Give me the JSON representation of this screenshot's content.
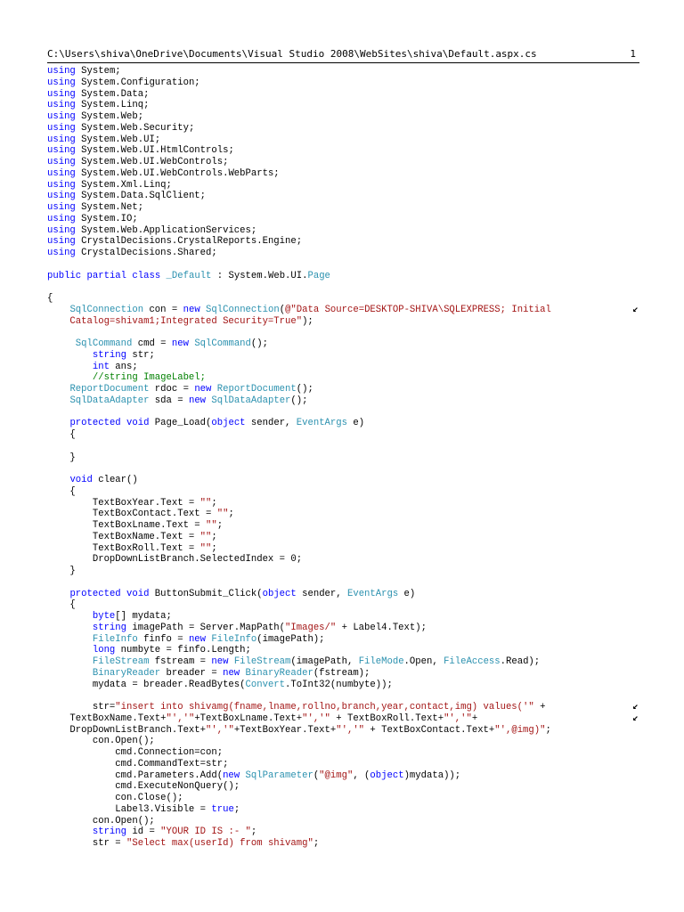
{
  "header": {
    "path": "C:\\Users\\shiva\\OneDrive\\Documents\\Visual Studio 2008\\WebSites\\shiva\\Default.aspx.cs",
    "page_number": "1"
  },
  "wrap_glyph": "↙",
  "colors": {
    "keyword": "#0000ff",
    "type": "#2b91af",
    "string": "#a31515",
    "comment": "#008000"
  },
  "code_lines": [
    [
      [
        "kw",
        "using"
      ],
      [
        "p",
        " System;"
      ]
    ],
    [
      [
        "kw",
        "using"
      ],
      [
        "p",
        " System.Configuration;"
      ]
    ],
    [
      [
        "kw",
        "using"
      ],
      [
        "p",
        " System.Data;"
      ]
    ],
    [
      [
        "kw",
        "using"
      ],
      [
        "p",
        " System.Linq;"
      ]
    ],
    [
      [
        "kw",
        "using"
      ],
      [
        "p",
        " System.Web;"
      ]
    ],
    [
      [
        "kw",
        "using"
      ],
      [
        "p",
        " System.Web.Security;"
      ]
    ],
    [
      [
        "kw",
        "using"
      ],
      [
        "p",
        " System.Web.UI;"
      ]
    ],
    [
      [
        "kw",
        "using"
      ],
      [
        "p",
        " System.Web.UI.HtmlControls;"
      ]
    ],
    [
      [
        "kw",
        "using"
      ],
      [
        "p",
        " System.Web.UI.WebControls;"
      ]
    ],
    [
      [
        "kw",
        "using"
      ],
      [
        "p",
        " System.Web.UI.WebControls.WebParts;"
      ]
    ],
    [
      [
        "kw",
        "using"
      ],
      [
        "p",
        " System.Xml.Linq;"
      ]
    ],
    [
      [
        "kw",
        "using"
      ],
      [
        "p",
        " System.Data.SqlClient;"
      ]
    ],
    [
      [
        "kw",
        "using"
      ],
      [
        "p",
        " System.Net;"
      ]
    ],
    [
      [
        "kw",
        "using"
      ],
      [
        "p",
        " System.IO;"
      ]
    ],
    [
      [
        "kw",
        "using"
      ],
      [
        "p",
        " System.Web.ApplicationServices;"
      ]
    ],
    [
      [
        "kw",
        "using"
      ],
      [
        "p",
        " CrystalDecisions.CrystalReports.Engine;"
      ]
    ],
    [
      [
        "kw",
        "using"
      ],
      [
        "p",
        " CrystalDecisions.Shared;"
      ]
    ],
    [],
    [
      [
        "kw",
        "public"
      ],
      [
        "p",
        " "
      ],
      [
        "kw",
        "partial"
      ],
      [
        "p",
        " "
      ],
      [
        "kw",
        "class"
      ],
      [
        "p",
        " "
      ],
      [
        "ty",
        "_Default"
      ],
      [
        "p",
        " : System.Web.UI."
      ],
      [
        "ty",
        "Page"
      ]
    ],
    [],
    [
      [
        "p",
        "{"
      ]
    ],
    [
      [
        "p",
        "    "
      ],
      [
        "ty",
        "SqlConnection"
      ],
      [
        "p",
        " con = "
      ],
      [
        "kw",
        "new"
      ],
      [
        "p",
        " "
      ],
      [
        "ty",
        "SqlConnection"
      ],
      [
        "p",
        "("
      ],
      [
        "st",
        "@\"Data Source=DESKTOP-SHIVA\\SQLEXPRESS; Initial"
      ],
      [
        "wrap",
        ""
      ]
    ],
    [
      [
        "st",
        "    Catalog=shivam1;Integrated Security=True\""
      ],
      [
        "p",
        ");"
      ]
    ],
    [],
    [
      [
        "p",
        "     "
      ],
      [
        "ty",
        "SqlCommand"
      ],
      [
        "p",
        " cmd = "
      ],
      [
        "kw",
        "new"
      ],
      [
        "p",
        " "
      ],
      [
        "ty",
        "SqlCommand"
      ],
      [
        "p",
        "();"
      ]
    ],
    [
      [
        "p",
        "        "
      ],
      [
        "kw",
        "string"
      ],
      [
        "p",
        " str;"
      ]
    ],
    [
      [
        "p",
        "        "
      ],
      [
        "kw",
        "int"
      ],
      [
        "p",
        " ans;"
      ]
    ],
    [
      [
        "p",
        "        "
      ],
      [
        "cm",
        "//string ImageLabel;"
      ]
    ],
    [
      [
        "p",
        "    "
      ],
      [
        "ty",
        "ReportDocument"
      ],
      [
        "p",
        " rdoc = "
      ],
      [
        "kw",
        "new"
      ],
      [
        "p",
        " "
      ],
      [
        "ty",
        "ReportDocument"
      ],
      [
        "p",
        "();"
      ]
    ],
    [
      [
        "p",
        "    "
      ],
      [
        "ty",
        "SqlDataAdapter"
      ],
      [
        "p",
        " sda = "
      ],
      [
        "kw",
        "new"
      ],
      [
        "p",
        " "
      ],
      [
        "ty",
        "SqlDataAdapter"
      ],
      [
        "p",
        "();"
      ]
    ],
    [],
    [
      [
        "p",
        "    "
      ],
      [
        "kw",
        "protected"
      ],
      [
        "p",
        " "
      ],
      [
        "kw",
        "void"
      ],
      [
        "p",
        " Page_Load("
      ],
      [
        "kw",
        "object"
      ],
      [
        "p",
        " sender, "
      ],
      [
        "ty",
        "EventArgs"
      ],
      [
        "p",
        " e)"
      ]
    ],
    [
      [
        "p",
        "    {"
      ]
    ],
    [],
    [
      [
        "p",
        "    }"
      ]
    ],
    [],
    [
      [
        "p",
        "    "
      ],
      [
        "kw",
        "void"
      ],
      [
        "p",
        " clear()"
      ]
    ],
    [
      [
        "p",
        "    {"
      ]
    ],
    [
      [
        "p",
        "        TextBoxYear.Text = "
      ],
      [
        "st",
        "\"\""
      ],
      [
        "p",
        ";"
      ]
    ],
    [
      [
        "p",
        "        TextBoxContact.Text = "
      ],
      [
        "st",
        "\"\""
      ],
      [
        "p",
        ";"
      ]
    ],
    [
      [
        "p",
        "        TextBoxLname.Text = "
      ],
      [
        "st",
        "\"\""
      ],
      [
        "p",
        ";"
      ]
    ],
    [
      [
        "p",
        "        TextBoxName.Text = "
      ],
      [
        "st",
        "\"\""
      ],
      [
        "p",
        ";"
      ]
    ],
    [
      [
        "p",
        "        TextBoxRoll.Text = "
      ],
      [
        "st",
        "\"\""
      ],
      [
        "p",
        ";"
      ]
    ],
    [
      [
        "p",
        "        DropDownListBranch.SelectedIndex = 0;"
      ]
    ],
    [
      [
        "p",
        "    }"
      ]
    ],
    [],
    [
      [
        "p",
        "    "
      ],
      [
        "kw",
        "protected"
      ],
      [
        "p",
        " "
      ],
      [
        "kw",
        "void"
      ],
      [
        "p",
        " ButtonSubmit_Click("
      ],
      [
        "kw",
        "object"
      ],
      [
        "p",
        " sender, "
      ],
      [
        "ty",
        "EventArgs"
      ],
      [
        "p",
        " e)"
      ]
    ],
    [
      [
        "p",
        "    {"
      ]
    ],
    [
      [
        "p",
        "        "
      ],
      [
        "kw",
        "byte"
      ],
      [
        "p",
        "[] mydata;"
      ]
    ],
    [
      [
        "p",
        "        "
      ],
      [
        "kw",
        "string"
      ],
      [
        "p",
        " imagePath = Server.MapPath("
      ],
      [
        "st",
        "\"Images/\""
      ],
      [
        "p",
        " + Label4.Text);"
      ]
    ],
    [
      [
        "p",
        "        "
      ],
      [
        "ty",
        "FileInfo"
      ],
      [
        "p",
        " finfo = "
      ],
      [
        "kw",
        "new"
      ],
      [
        "p",
        " "
      ],
      [
        "ty",
        "FileInfo"
      ],
      [
        "p",
        "(imagePath);"
      ]
    ],
    [
      [
        "p",
        "        "
      ],
      [
        "kw",
        "long"
      ],
      [
        "p",
        " numbyte = finfo.Length;"
      ]
    ],
    [
      [
        "p",
        "        "
      ],
      [
        "ty",
        "FileStream"
      ],
      [
        "p",
        " fstream = "
      ],
      [
        "kw",
        "new"
      ],
      [
        "p",
        " "
      ],
      [
        "ty",
        "FileStream"
      ],
      [
        "p",
        "(imagePath, "
      ],
      [
        "ty",
        "FileMode"
      ],
      [
        "p",
        ".Open, "
      ],
      [
        "ty",
        "FileAccess"
      ],
      [
        "p",
        ".Read);"
      ]
    ],
    [
      [
        "p",
        "        "
      ],
      [
        "ty",
        "BinaryReader"
      ],
      [
        "p",
        " breader = "
      ],
      [
        "kw",
        "new"
      ],
      [
        "p",
        " "
      ],
      [
        "ty",
        "BinaryReader"
      ],
      [
        "p",
        "(fstream);"
      ]
    ],
    [
      [
        "p",
        "        mydata = breader.ReadBytes("
      ],
      [
        "ty",
        "Convert"
      ],
      [
        "p",
        ".ToInt32(numbyte));"
      ]
    ],
    [],
    [
      [
        "p",
        "        str="
      ],
      [
        "st",
        "\"insert into shivamg(fname,lname,rollno,branch,year,contact,img) values('\""
      ],
      [
        "p",
        " +"
      ],
      [
        "wrap",
        ""
      ]
    ],
    [
      [
        "p",
        "    TextBoxName.Text+"
      ],
      [
        "st",
        "\"','\""
      ],
      [
        "p",
        "+TextBoxLname.Text+"
      ],
      [
        "st",
        "\"','\""
      ],
      [
        "p",
        " + TextBoxRoll.Text+"
      ],
      [
        "st",
        "\"','\""
      ],
      [
        "p",
        "+"
      ],
      [
        "wrap",
        ""
      ]
    ],
    [
      [
        "p",
        "    DropDownListBranch.Text+"
      ],
      [
        "st",
        "\"','\""
      ],
      [
        "p",
        "+TextBoxYear.Text+"
      ],
      [
        "st",
        "\"','\""
      ],
      [
        "p",
        " + TextBoxContact.Text+"
      ],
      [
        "st",
        "\"',@img)\""
      ],
      [
        "p",
        ";"
      ]
    ],
    [
      [
        "p",
        "        con.Open();"
      ]
    ],
    [
      [
        "p",
        "            cmd.Connection=con;"
      ]
    ],
    [
      [
        "p",
        "            cmd.CommandText=str;"
      ]
    ],
    [
      [
        "p",
        "            cmd.Parameters.Add("
      ],
      [
        "kw",
        "new"
      ],
      [
        "p",
        " "
      ],
      [
        "ty",
        "SqlParameter"
      ],
      [
        "p",
        "("
      ],
      [
        "st",
        "\"@img\""
      ],
      [
        "p",
        ", ("
      ],
      [
        "kw",
        "object"
      ],
      [
        "p",
        ")mydata));"
      ]
    ],
    [
      [
        "p",
        "            cmd.ExecuteNonQuery();"
      ]
    ],
    [
      [
        "p",
        "            con.Close();"
      ]
    ],
    [
      [
        "p",
        "            Label3.Visible = "
      ],
      [
        "kw",
        "true"
      ],
      [
        "p",
        ";"
      ]
    ],
    [
      [
        "p",
        "        con.Open();"
      ]
    ],
    [
      [
        "p",
        "        "
      ],
      [
        "kw",
        "string"
      ],
      [
        "p",
        " id = "
      ],
      [
        "st",
        "\"YOUR ID IS :- \""
      ],
      [
        "p",
        ";"
      ]
    ],
    [
      [
        "p",
        "        str = "
      ],
      [
        "st",
        "\"Select max(userId) from shivamg\""
      ],
      [
        "p",
        ";"
      ]
    ]
  ]
}
